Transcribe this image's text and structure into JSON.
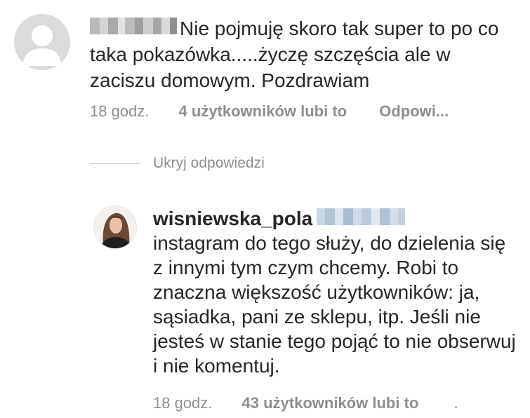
{
  "comment": {
    "text": "Nie pojmuję skoro tak super to po co taka pokazówka.....życzę szczęścia ale w zaciszu domowym. Pozdrawiam",
    "time": "18 godz.",
    "likes": "4 użytkowników lubi to",
    "reply": "Odpowi..."
  },
  "hide_replies_label": "Ukryj odpowiedzi",
  "reply": {
    "username": "wisniewska_pola",
    "text": "instagram do tego służy, do dzielenia się z innymi tym czym chcemy. Robi to znaczna większość użytkowników: ja, sąsiadka, pani ze sklepu, itp. Jeśli nie jesteś w stanie tego pojąć to nie obserwuj i nie komentuj.",
    "time": "18 godz.",
    "likes": "43 użytkowników lubi to"
  },
  "icons": {
    "default_avatar": "default-avatar-icon",
    "user_avatar": "profile-photo"
  },
  "colors": {
    "text": "#262626",
    "meta": "#8e8e8e",
    "avatar_bg": "#dbdbdb",
    "divider": "#c7c7c7"
  }
}
